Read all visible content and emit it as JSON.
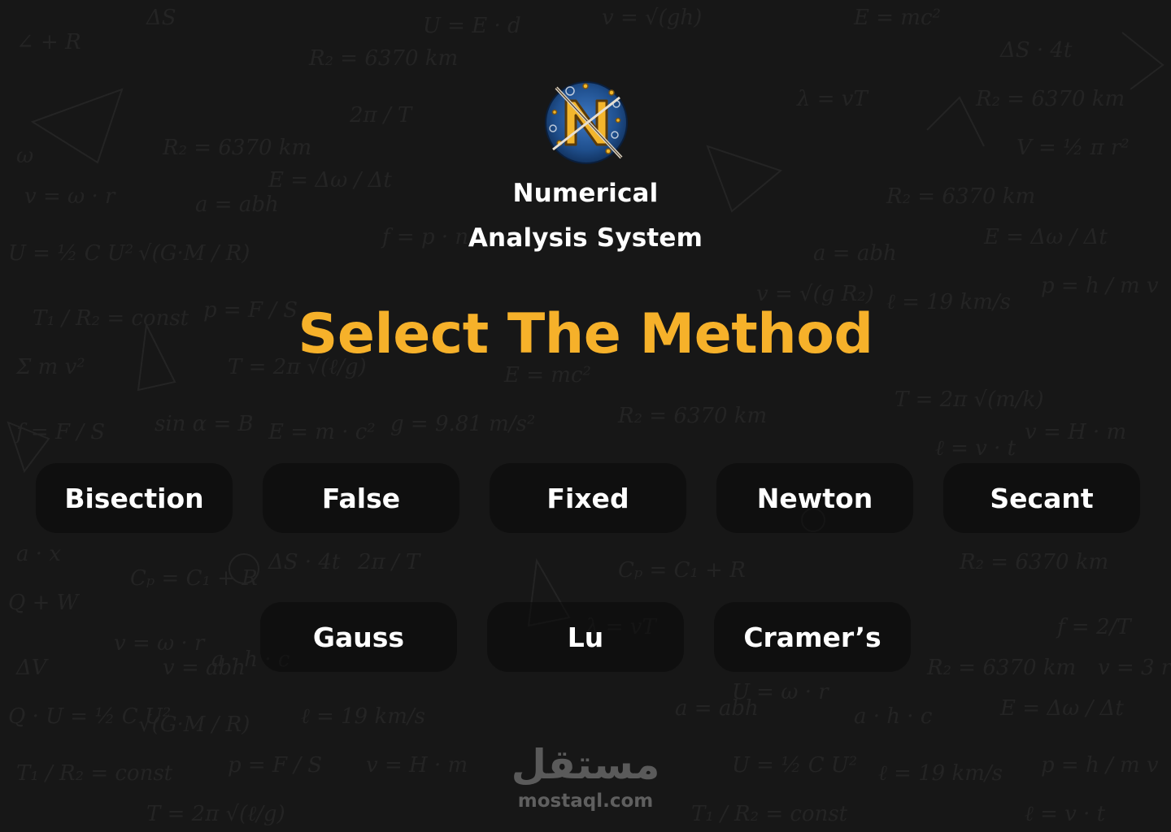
{
  "app": {
    "title_line1": "Numerical",
    "title_line2": "Analysis System",
    "logo_icon": "numerical-logo-icon"
  },
  "heading": "Select The Method",
  "colors": {
    "background": "#171717",
    "accent": "#f6b12a",
    "button_bg": "#0f0f0f",
    "text": "#ffffff"
  },
  "methods_row1": [
    "Bisection",
    "False",
    "Fixed",
    "Newton",
    "Secant"
  ],
  "methods_row2": [
    "Gauss",
    "Lu",
    "Cramer’s"
  ],
  "watermark": {
    "arabic": "مستقل",
    "domain": "mostaql.com"
  }
}
